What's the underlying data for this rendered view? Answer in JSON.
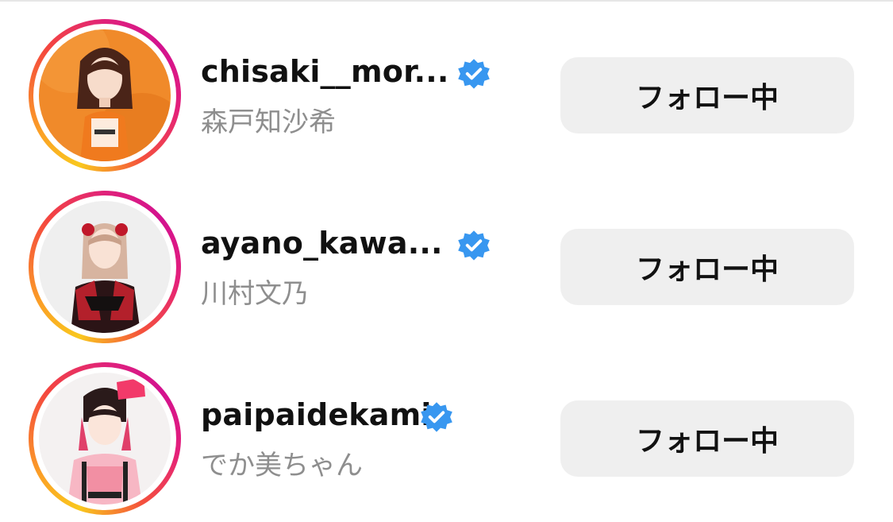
{
  "accounts": [
    {
      "username": "chisaki__mor...",
      "full_name": "森戸知沙希",
      "verified": true,
      "button_label": "フォロー中",
      "avatar_icon": "user-photo"
    },
    {
      "username": "ayano_kawa...",
      "full_name": "川村文乃",
      "verified": true,
      "button_label": "フォロー中",
      "avatar_icon": "user-photo"
    },
    {
      "username": "paipaidekami",
      "full_name": "でか美ちゃん",
      "verified": true,
      "button_label": "フォロー中",
      "avatar_icon": "user-photo"
    }
  ],
  "colors": {
    "verified_badge": "#3897f0",
    "button_bg": "#efefef",
    "secondary_text": "#8e8e8e"
  },
  "icons": {
    "verified": "verified-badge-icon"
  }
}
